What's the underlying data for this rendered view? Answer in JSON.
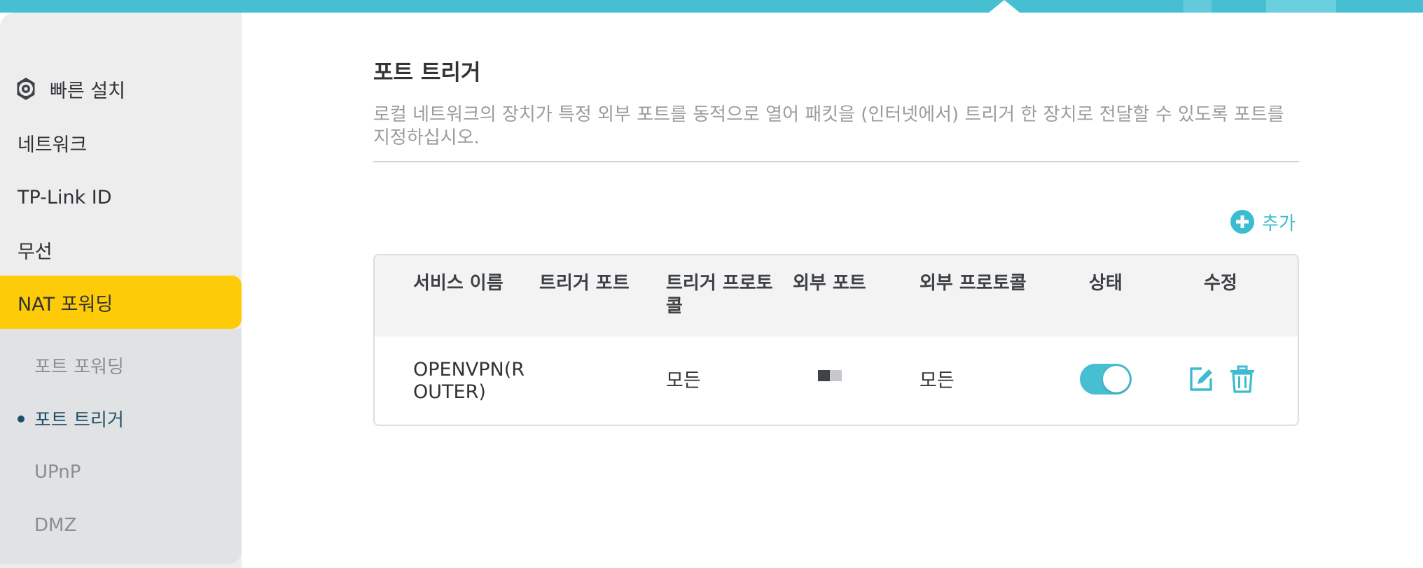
{
  "sidebar": {
    "items": [
      {
        "label": "빠른 설치",
        "icon": "gear-icon"
      },
      {
        "label": "네트워크"
      },
      {
        "label": "TP-Link ID"
      },
      {
        "label": "무선"
      },
      {
        "label": "NAT 포워딩",
        "active": true
      }
    ],
    "subitems": [
      {
        "label": "포트 포워딩"
      },
      {
        "label": "포트 트리거",
        "current": true
      },
      {
        "label": "UPnP"
      },
      {
        "label": "DMZ"
      }
    ]
  },
  "main": {
    "title": "포트 트리거",
    "description": "로컬 네트워크의 장치가 특정 외부 포트를 동적으로 열어 패킷을 (인터넷에서) 트리거 한 장치로 전달할 수 있도록 포트를 지정하십시오.",
    "add_label": "추가",
    "table": {
      "headers": [
        "서비스 이름",
        "트리거 포트",
        "트리거 프로토콜",
        "외부 포트",
        "외부 프로토콜",
        "상태",
        "수정"
      ],
      "rows": [
        {
          "service_name": "OPENVPN(ROUTER)",
          "trigger_port": "",
          "trigger_protocol": "모든",
          "external_protocol": "모든",
          "status_on": true
        }
      ]
    }
  },
  "colors": {
    "accent": "#47bfd3",
    "active_nav": "#fdcb07",
    "add_text": "#3cbccf"
  }
}
